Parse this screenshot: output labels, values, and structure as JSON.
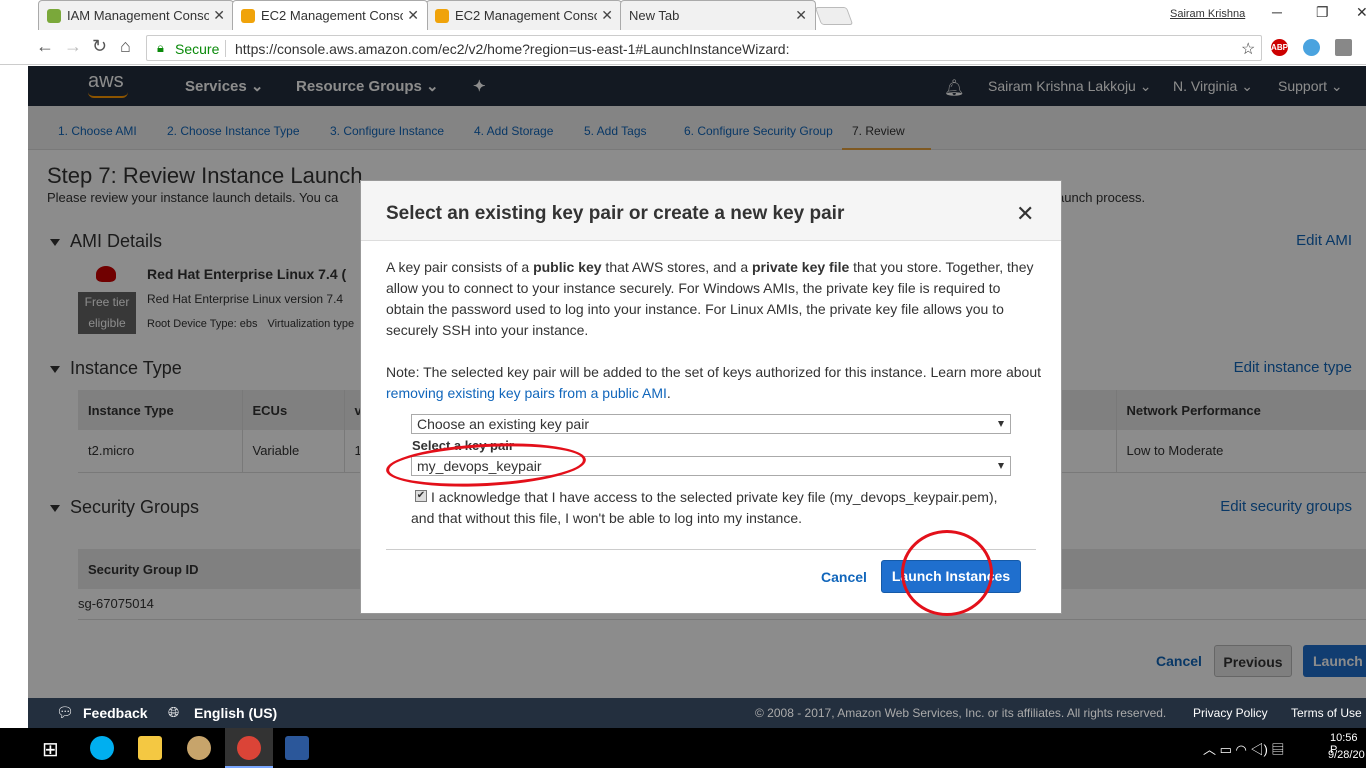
{
  "browser": {
    "tabs": [
      {
        "label": "IAM Management Conso",
        "icon_color": "#7aa83a"
      },
      {
        "label": "EC2 Management Conso",
        "icon_color": "#f0a30a"
      },
      {
        "label": "EC2 Management Conso",
        "icon_color": "#f0a30a"
      },
      {
        "label": "New Tab",
        "icon_color": ""
      }
    ],
    "close_glyph": "✕",
    "window_user": "Sairam Krishna",
    "secure_label": "Secure",
    "url": "https://console.aws.amazon.com/ec2/v2/home?region=us-east-1#LaunchInstanceWizard:"
  },
  "aws_header": {
    "logo": "aws",
    "services": "Services",
    "resource_groups": "Resource Groups",
    "user": "Sairam Krishna Lakkoju",
    "region": "N. Virginia",
    "support": "Support",
    "brand_color": "#232f3e",
    "accent_color": "#ff9900"
  },
  "steps": [
    "1. Choose AMI",
    "2. Choose Instance Type",
    "3. Configure Instance",
    "4. Add Storage",
    "5. Add Tags",
    "6. Configure Security Group",
    "7. Review"
  ],
  "page": {
    "title": "Step 7: Review Instance Launch",
    "subtitle_left": "Please review your instance launch details. You ca",
    "subtitle_right": "aunch process.",
    "ami_section": "AMI Details",
    "edit_ami": "Edit AMI",
    "ami_name": "Red Hat Enterprise Linux 7.4 (",
    "free_tier_1": "Free tier",
    "free_tier_2": "eligible",
    "ami_desc": "Red Hat Enterprise Linux version 7.4",
    "ami_root": "Root Device Type: ebs",
    "ami_virt": "Virtualization type",
    "instance_section": "Instance Type",
    "edit_instance": "Edit instance type",
    "instance_table": {
      "headers": [
        "Instance Type",
        "ECUs",
        "v"
      ],
      "row": [
        "t2.micro",
        "Variable",
        "1"
      ],
      "right_header": "Network Performance",
      "right_value": "Low to Moderate"
    },
    "sg_section": "Security Groups",
    "edit_sg": "Edit security groups",
    "sg_header": "Security Group ID",
    "sg_value": "sg-67075014",
    "cancel": "Cancel",
    "previous": "Previous",
    "launch": "Launch"
  },
  "modal": {
    "title": "Select an existing key pair or create a new key pair",
    "close": "✕",
    "p1_a": "A key pair consists of a ",
    "p1_b": "public key",
    "p1_c": " that AWS stores, and a ",
    "p1_d": "private key file",
    "p1_e": " that you store. Together, they allow you to connect to your instance securely. For Windows AMIs, the private key file is required to obtain the password used to log into your instance. For Linux AMIs, the private key file allows you to securely SSH into your instance.",
    "p2": "Note: The selected key pair will be added to the set of keys authorized for this instance. Learn more about",
    "p2_link": "removing existing key pairs from a public AMI",
    "p2_end": ".",
    "select_mode": "Choose an existing key pair",
    "select_label": "Select a key pair",
    "keypair": "my_devops_keypair",
    "ack": "I acknowledge that I have access to the selected private key file (my_devops_keypair.pem), and that without this file, I won't be able to log into my instance.",
    "ack_checked": true,
    "cancel": "Cancel",
    "launch": "Launch Instances"
  },
  "console_footer": {
    "feedback": "Feedback",
    "language": "English (US)",
    "copyright": "© 2008 - 2017, Amazon Web Services, Inc. or its affiliates. All rights reserved.",
    "privacy": "Privacy Policy",
    "terms": "Terms of Use"
  },
  "taskbar": {
    "time": "10:56 P",
    "date": "9/28/20"
  }
}
